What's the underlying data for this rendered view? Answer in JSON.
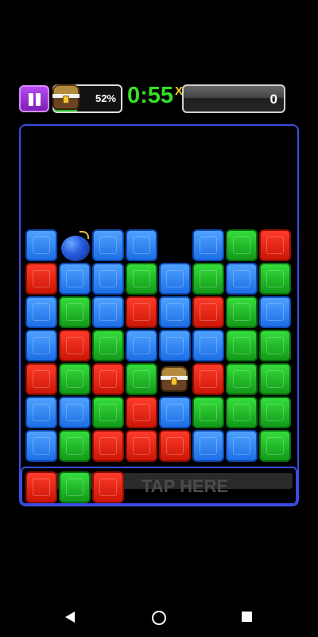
{
  "hud": {
    "chest_progress_text": "52%",
    "chest_progress_fraction": 0.35,
    "timer": "0:55",
    "multiplier": "X",
    "score": "0"
  },
  "board": {
    "colors": {
      "blue": "#1d6fe6",
      "green": "#129a19",
      "red": "#cc1606",
      "border": "#3b4de0"
    },
    "rows": [
      [
        "blue",
        "bomb",
        "blue",
        "blue",
        "empty",
        "blue",
        "green",
        "red"
      ],
      [
        "red",
        "blue",
        "blue",
        "green",
        "blue",
        "green",
        "blue",
        "green"
      ],
      [
        "blue",
        "green",
        "blue",
        "red",
        "blue",
        "red",
        "green",
        "blue"
      ],
      [
        "blue",
        "red",
        "green",
        "blue",
        "blue",
        "blue",
        "green",
        "green"
      ],
      [
        "red",
        "green",
        "red",
        "green",
        "chest",
        "red",
        "green",
        "green"
      ],
      [
        "blue",
        "blue",
        "green",
        "red",
        "blue",
        "green",
        "green",
        "green"
      ],
      [
        "blue",
        "green",
        "red",
        "red",
        "red",
        "blue",
        "blue",
        "green"
      ]
    ]
  },
  "tap_strip": {
    "label": "TAP HERE",
    "queue": [
      "red",
      "green",
      "red"
    ]
  },
  "icons": {
    "pause": "pause-icon",
    "chest": "treasure-chest-icon",
    "bomb": "bomb-icon",
    "back": "back-icon",
    "home": "home-icon",
    "recents": "recents-icon"
  }
}
